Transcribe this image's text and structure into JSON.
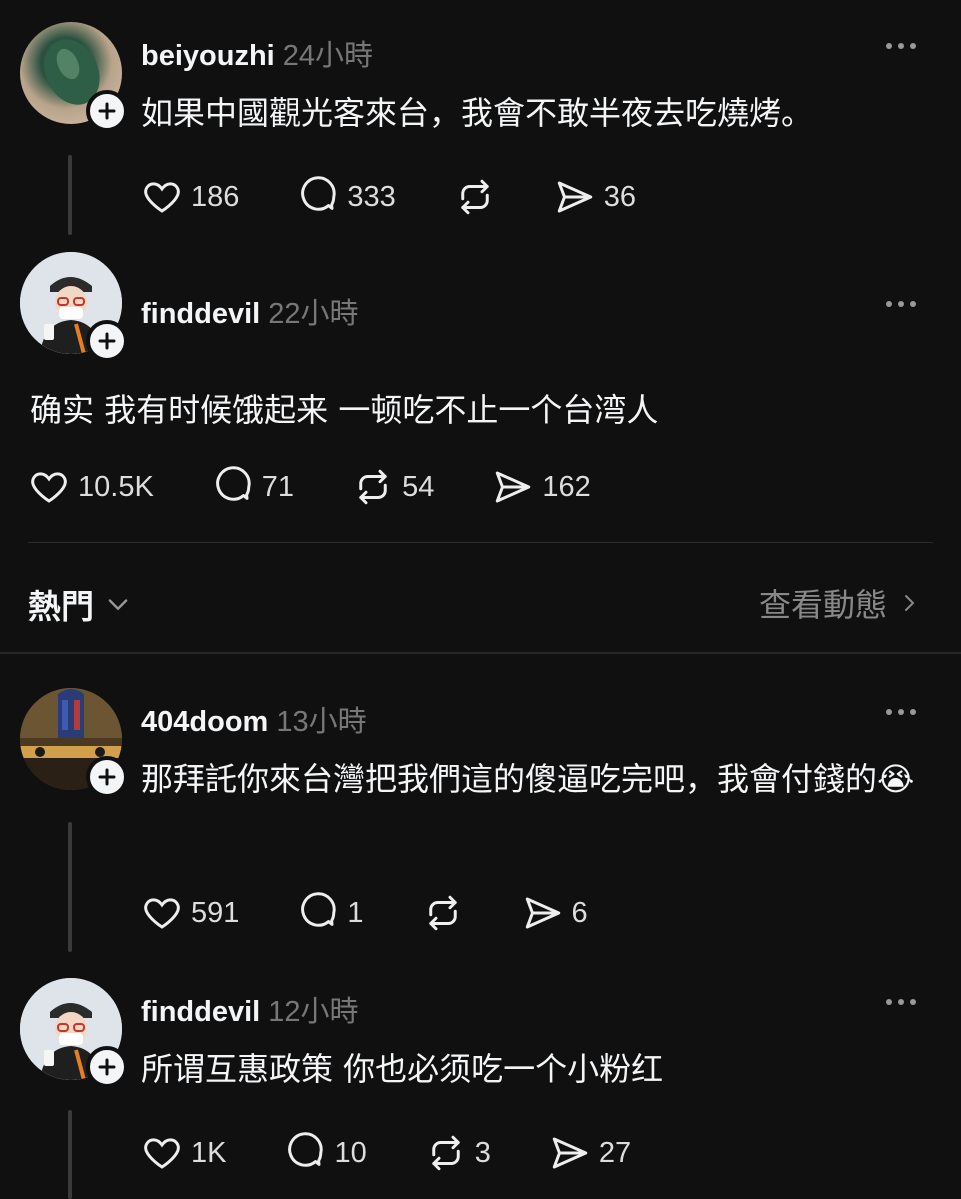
{
  "posts": [
    {
      "username": "beiyouzhi",
      "time": "24小時",
      "text": "如果中國觀光客來台，我會不敢半夜去吃燒烤。",
      "likes": "186",
      "comments": "333",
      "reposts": "",
      "shares": "36"
    },
    {
      "username": "finddevil",
      "time": "22小時",
      "text": "确实 我有时候饿起来 一顿吃不止一个台湾人",
      "likes": "10.5K",
      "comments": "71",
      "reposts": "54",
      "shares": "162"
    },
    {
      "username": "404doom",
      "time": "13小時",
      "text": "那拜託你來台灣把我們這的傻逼吃完吧，我會付錢的😭",
      "likes": "591",
      "comments": "1",
      "reposts": "",
      "shares": "6"
    },
    {
      "username": "finddevil",
      "time": "12小時",
      "text": "所谓互惠政策 你也必须吃一个小粉红",
      "likes": "1K",
      "comments": "10",
      "reposts": "3",
      "shares": "27"
    }
  ],
  "section": {
    "sort_label": "熱門",
    "view_activity": "查看動態"
  },
  "colors": {
    "background": "#101010",
    "text": "#f3f5f7",
    "muted": "#777777"
  }
}
